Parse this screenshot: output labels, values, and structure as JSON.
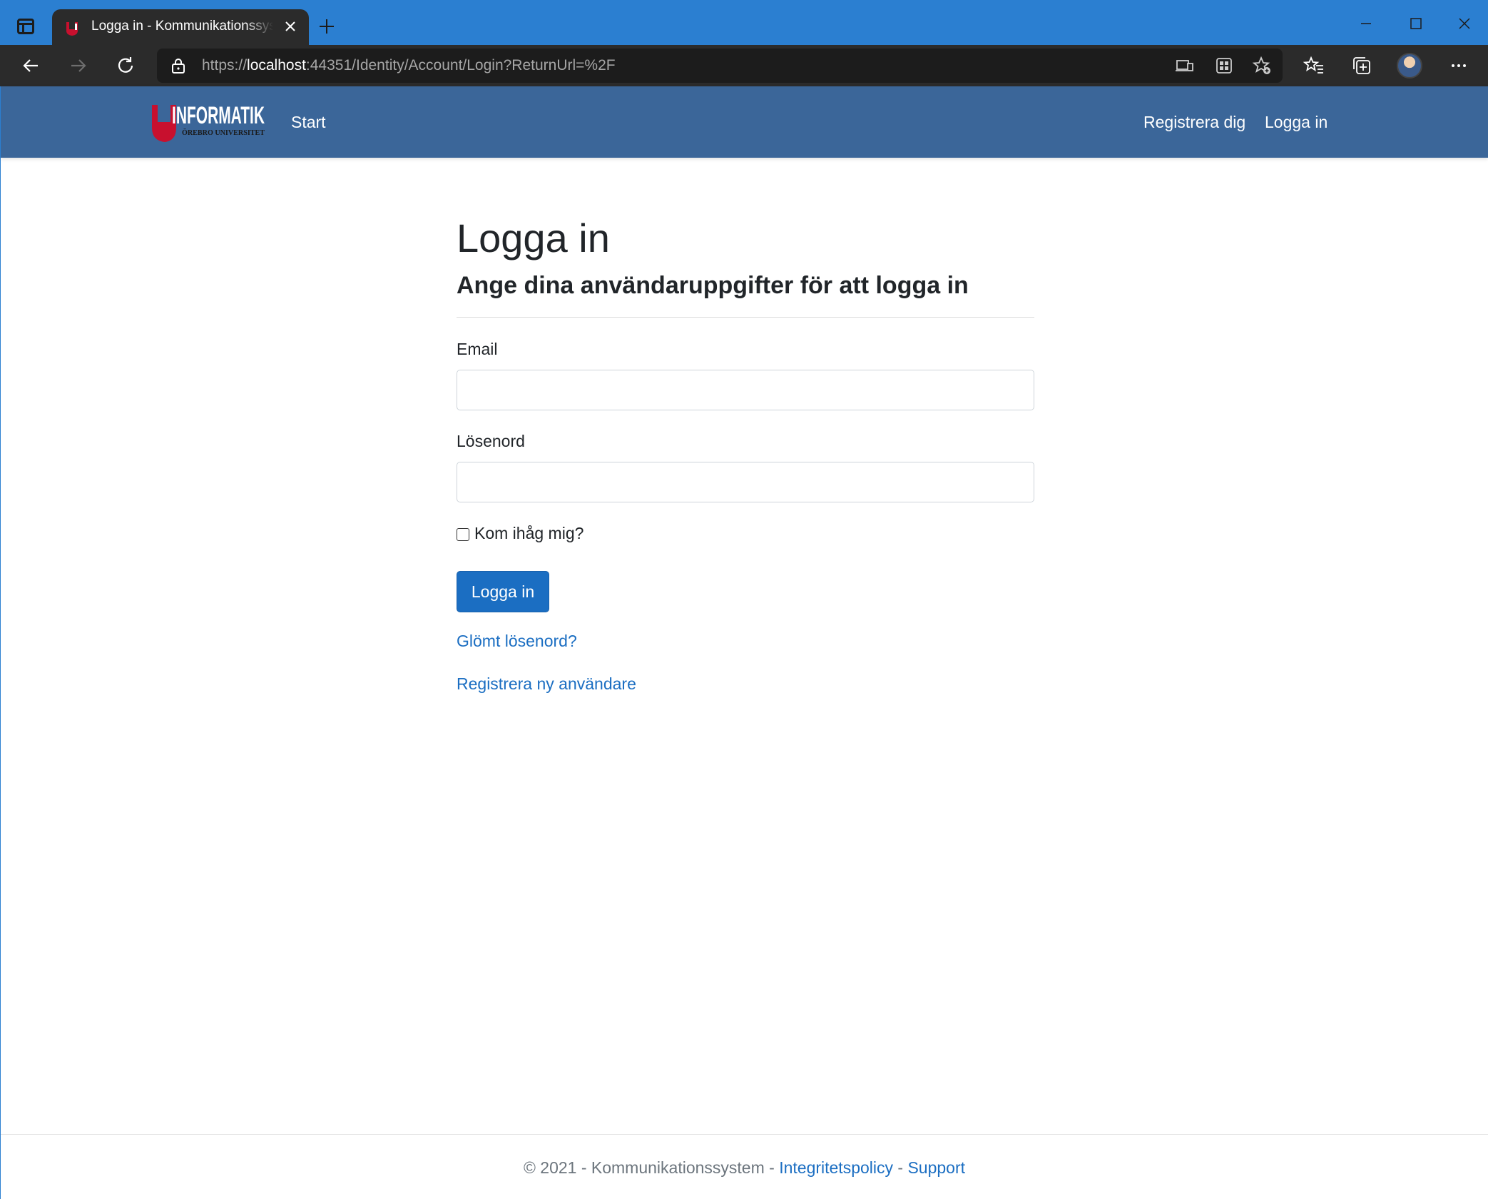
{
  "browser": {
    "tab_title": "Logga in - Kommunikationssystem",
    "url": {
      "scheme": "https://",
      "host": "localhost",
      "rest": ":44351/Identity/Account/Login?ReturnUrl=%2F"
    }
  },
  "navbar": {
    "brand": {
      "name": "INFORMATIK",
      "subtitle": "ÖREBRO UNIVERSITET"
    },
    "start_label": "Start",
    "register_label": "Registrera dig",
    "login_label": "Logga in"
  },
  "page": {
    "title": "Logga in",
    "subtitle": "Ange dina användaruppgifter för att logga in",
    "email_label": "Email",
    "email_value": "",
    "password_label": "Lösenord",
    "password_value": "",
    "remember_label": "Kom ihåg mig?",
    "remember_checked": false,
    "submit_label": "Logga in",
    "forgot_link": "Glömt lösenord?",
    "register_link": "Registrera ny användare"
  },
  "footer": {
    "copyright": "© 2021 - Kommunikationssystem - ",
    "privacy_link": "Integritetspolicy",
    "separator": " - ",
    "support_link": "Support"
  },
  "colors": {
    "titlebar": "#2b7fd1",
    "navbar": "#3b6699",
    "primary": "#1b6ec2",
    "text": "#212529",
    "muted": "#6c757d",
    "logo_red": "#c8102e"
  }
}
